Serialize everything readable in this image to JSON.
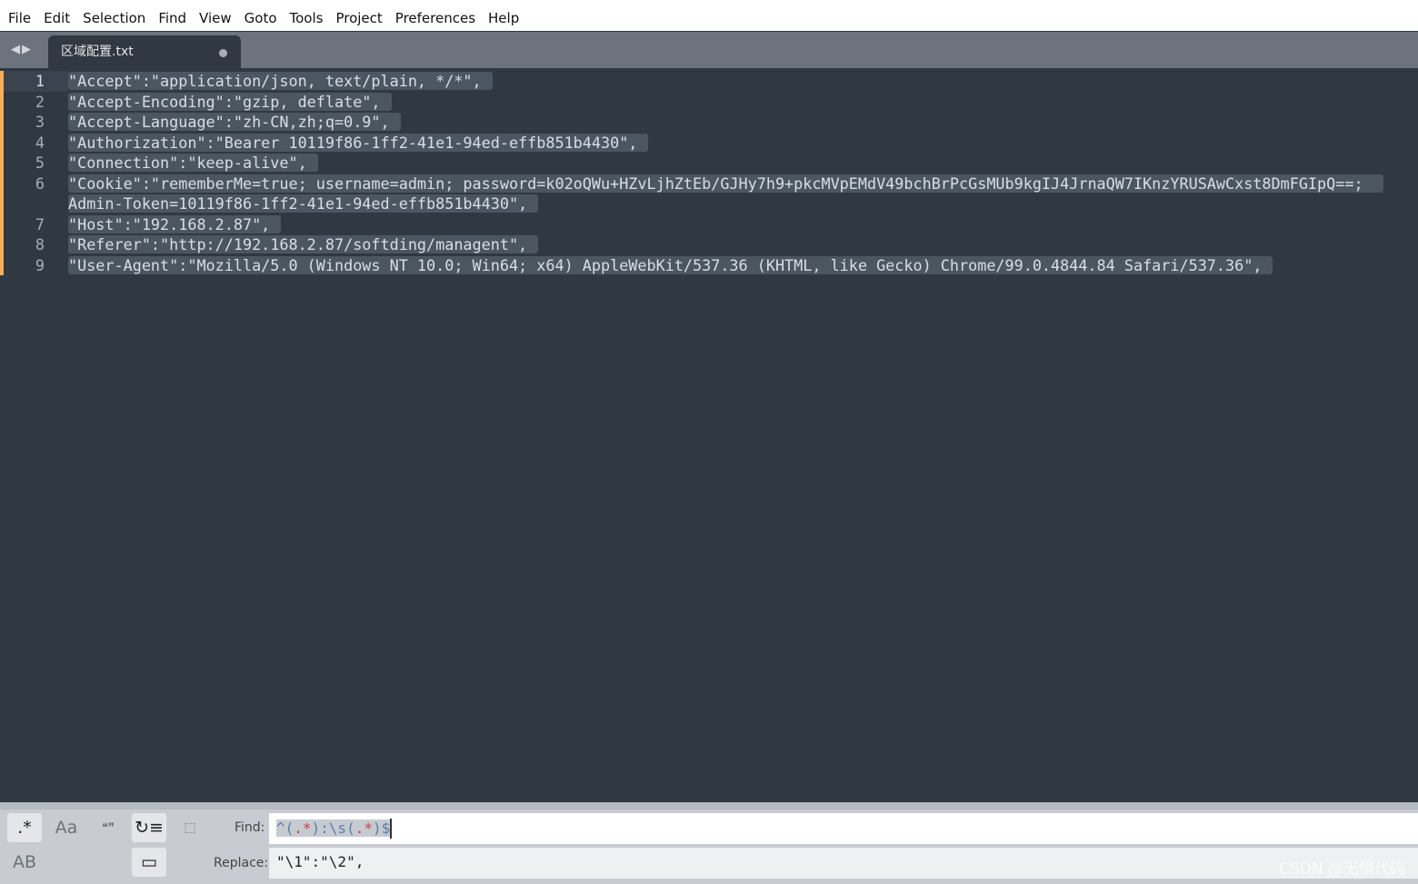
{
  "menu": [
    "File",
    "Edit",
    "Selection",
    "Find",
    "View",
    "Goto",
    "Tools",
    "Project",
    "Preferences",
    "Help"
  ],
  "tab": {
    "title": "区域配置.txt"
  },
  "lines": [
    "\"Accept\":\"application/json, text/plain, */*\",",
    "\"Accept-Encoding\":\"gzip, deflate\",",
    "\"Accept-Language\":\"zh-CN,zh;q=0.9\",",
    "\"Authorization\":\"Bearer 10119f86-1ff2-41e1-94ed-effb851b4430\",",
    "\"Connection\":\"keep-alive\",",
    "\"Cookie\":\"rememberMe=true; username=admin; password=k02oQWu+HZvLjhZtEb/GJHy7h9+pkcMVpEMdV49bchBrPcGsMUb9kgIJ4JrnaQW7IKnzYRUSAwCxst8DmFGIpQ==; Admin-Token=10119f86-1ff2-41e1-94ed-effb851b4430\",",
    "\"Host\":\"192.168.2.87\",",
    "\"Referer\":\"http://192.168.2.87/softding/managent\",",
    "\"User-Agent\":\"Mozilla/5.0 (Windows NT 10.0; Win64; x64) AppleWebKit/537.36 (KHTML, like Gecko) Chrome/99.0.4844.84 Safari/537.36\","
  ],
  "line_numbers": [
    "1",
    "2",
    "3",
    "4",
    "5",
    "6",
    "7",
    "8",
    "9"
  ],
  "find_panel": {
    "regex_label": ".*",
    "case_label": "Aa",
    "word_label": "❝❞",
    "preserve_case_label": "AB",
    "find_label": "Find:",
    "replace_label": "Replace:",
    "find_parts": [
      "^(",
      ".*",
      "):\\s(",
      ".*",
      ")$"
    ],
    "replace_value": "\"\\1\":\"\\2\","
  },
  "watermark": "CSDN @无惧代码"
}
